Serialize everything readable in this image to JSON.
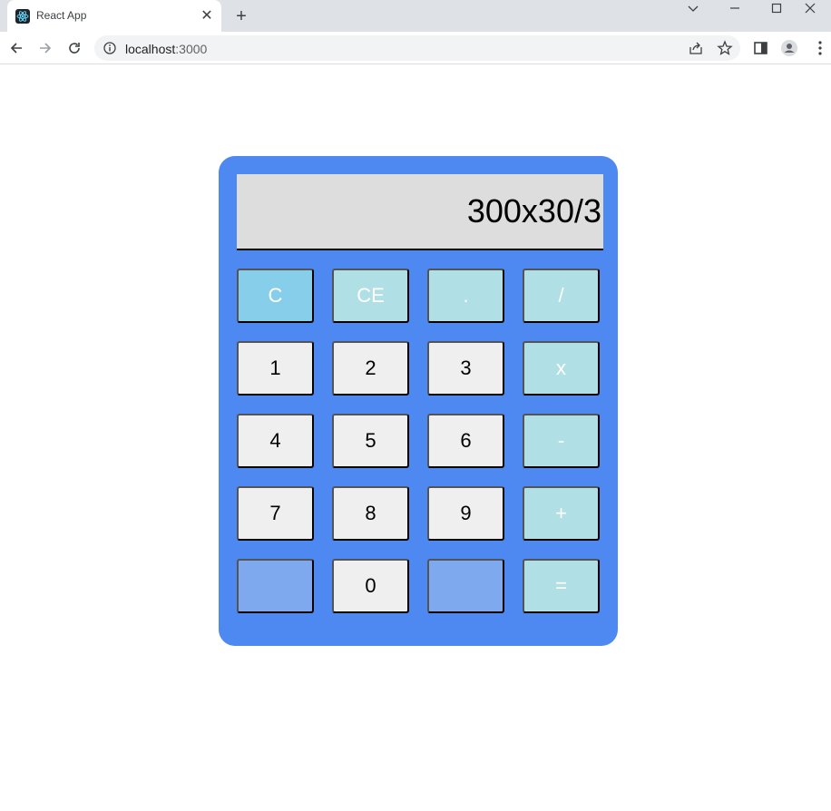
{
  "browser": {
    "tab_title": "React App",
    "tab_close": "✕",
    "new_tab": "+",
    "url_host": "localhost",
    "url_port": ":3000"
  },
  "calculator": {
    "display": "300x30/3",
    "keys": {
      "clear": "C",
      "clear_entry": "CE",
      "decimal": ".",
      "divide": "/",
      "one": "1",
      "two": "2",
      "three": "3",
      "multiply": "x",
      "four": "4",
      "five": "5",
      "six": "6",
      "subtract": "-",
      "seven": "7",
      "eight": "8",
      "nine": "9",
      "add": "+",
      "zero": "0",
      "equals": "="
    }
  },
  "colors": {
    "calculator_body": "#4d89f0",
    "display_bg": "#dddddd",
    "number_key": "#efefef",
    "operator_key": "#b0dfe5",
    "clear_key": "#87ceeb",
    "blank_key": "#7fa9ee"
  }
}
